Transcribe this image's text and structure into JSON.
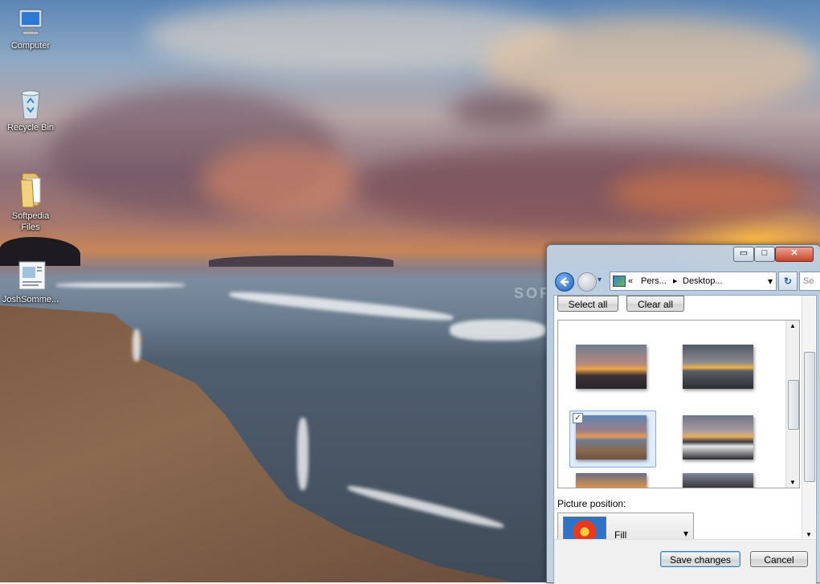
{
  "desktop": {
    "icons": [
      {
        "label": "Computer",
        "icon": "computer-icon"
      },
      {
        "label": "Recycle Bin",
        "icon": "recycle-bin-icon"
      },
      {
        "label": "Softpedia Files",
        "icon": "folder-icon"
      },
      {
        "label": "JoshSomme...",
        "icon": "document-icon"
      }
    ]
  },
  "window": {
    "caption_buttons": {
      "minimize": "▭",
      "maximize": "□",
      "close": "✕"
    },
    "address": {
      "overflow": "«",
      "crumb1": "Pers...",
      "separator": "▸",
      "crumb2": "Desktop...",
      "dropdown": "▾",
      "refresh": "↻",
      "search_placeholder": "Se"
    },
    "buttons": {
      "select_all": "Select all",
      "clear_all": "Clear all"
    },
    "gallery": {
      "thumbnails": [
        {
          "name": "sunset-rocks",
          "checked": false
        },
        {
          "name": "sunset-shore",
          "checked": false
        },
        {
          "name": "sunset-beach",
          "checked": true
        },
        {
          "name": "sunset-surf",
          "checked": false
        },
        {
          "name": "sunset-horizon",
          "checked": false
        },
        {
          "name": "sunset-cove",
          "checked": false
        }
      ],
      "check_mark": "✓"
    },
    "picture_position": {
      "label": "Picture position:",
      "value": "Fill",
      "arrow": "▾"
    },
    "footer": {
      "save": "Save changes",
      "cancel": "Cancel"
    }
  },
  "watermark": "SOFTPEDIA"
}
